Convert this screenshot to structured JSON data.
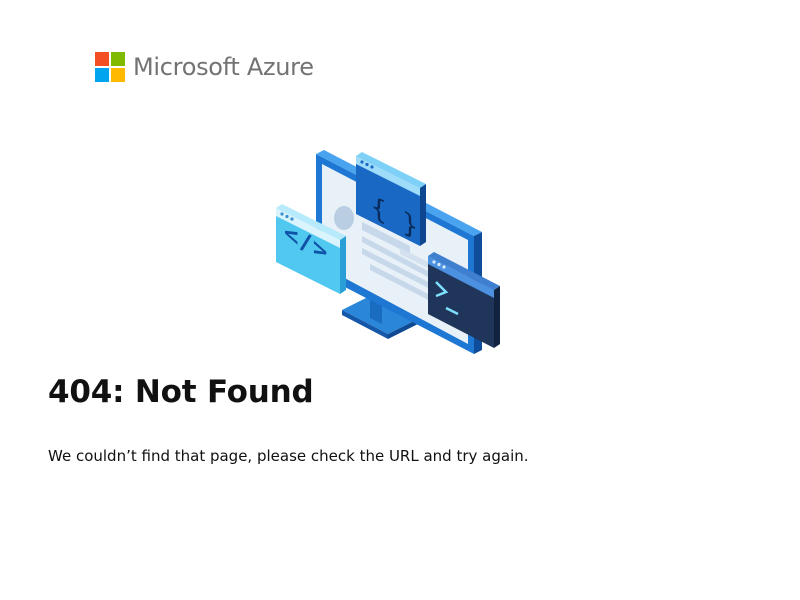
{
  "brand": {
    "name": "Microsoft Azure",
    "logo_colors": [
      "#f25022",
      "#7fba00",
      "#00a4ef",
      "#ffb900"
    ]
  },
  "illustration": {
    "name": "computer-code-windows-illustration",
    "palette": {
      "monitor_frame": "#1e77d2",
      "screen": "#e8f0f8",
      "brackets_window": "#1968c4",
      "code_window": "#50c8ef",
      "terminal_window": "#1f3559"
    }
  },
  "error": {
    "title": "404: Not Found",
    "message": "We couldn’t find that page, please check the URL and try again."
  }
}
